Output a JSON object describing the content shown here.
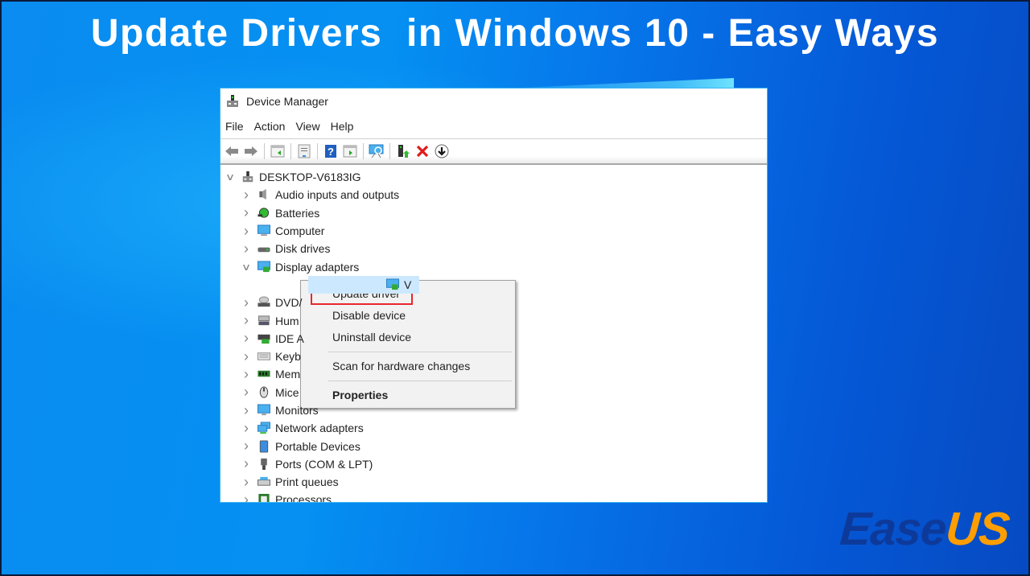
{
  "headline": "Update Drivers  in Windows 10 - Easy Ways",
  "window": {
    "title": "Device Manager",
    "menu": [
      "File",
      "Action",
      "View",
      "Help"
    ],
    "toolbar": [
      "back-icon",
      "forward-icon",
      "show-hide-console-tree-icon",
      "properties-icon",
      "help-icon",
      "show-action-pane-icon",
      "scan-hardware-icon",
      "update-driver-icon",
      "uninstall-icon",
      "disable-icon"
    ]
  },
  "tree": {
    "root": "DESKTOP-V6183IG",
    "items": [
      {
        "label": "Audio inputs and outputs",
        "expanded": false
      },
      {
        "label": "Batteries",
        "expanded": false
      },
      {
        "label": "Computer",
        "expanded": false
      },
      {
        "label": "Disk drives",
        "expanded": false
      },
      {
        "label": "Display adapters",
        "expanded": true
      },
      {
        "label": "V",
        "child": true,
        "selected": true
      },
      {
        "label": "DVD/",
        "expanded": false
      },
      {
        "label": "Hum",
        "expanded": false
      },
      {
        "label": "IDE A",
        "expanded": false
      },
      {
        "label": "Keyb",
        "expanded": false
      },
      {
        "label": "Mem",
        "expanded": false
      },
      {
        "label": "Mice",
        "expanded": false
      },
      {
        "label": "Monitors",
        "expanded": false
      },
      {
        "label": "Network adapters",
        "expanded": false
      },
      {
        "label": "Portable Devices",
        "expanded": false
      },
      {
        "label": "Ports (COM & LPT)",
        "expanded": false
      },
      {
        "label": "Print queues",
        "expanded": false
      },
      {
        "label": "Processors",
        "expanded": false
      }
    ]
  },
  "context_menu": {
    "items": [
      "Update driver",
      "Disable device",
      "Uninstall device",
      "Scan for hardware changes",
      "Properties"
    ],
    "highlighted": "Update driver"
  },
  "logo": {
    "part1": "Ease",
    "part2": "US"
  },
  "colors": {
    "highlight_border": "#e8262d",
    "logo_blue": "#0d3a9a",
    "logo_orange": "#ff9e00",
    "selection": "#cce8ff"
  }
}
